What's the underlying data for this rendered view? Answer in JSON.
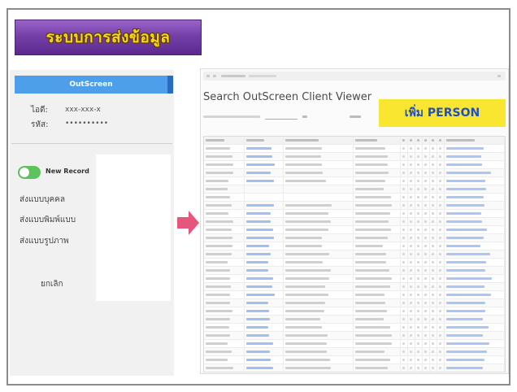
{
  "banner": {
    "title": "ระบบการส่งข้อมูล"
  },
  "login": {
    "button_label": "OutScreen",
    "id_label": "ไอดี:",
    "id_value": "xxx-xxx-x",
    "password_label": "รหัส:",
    "password_value": "••••••••••"
  },
  "options": {
    "toggle_label": "New Record",
    "items": [
      "ส่งแบบบุคคล",
      "ส่งแบบพิมพ์แบบ",
      "ส่งแบบรูปภาพ"
    ],
    "cancel_label": "ยกเลิก"
  },
  "viewer": {
    "title": "Search OutScreen Client Viewer",
    "add_button_label": "เพิ่ม PERSON"
  },
  "icons": {
    "arrow": "right-arrow-icon",
    "toggle": "toggle-switch"
  },
  "colors": {
    "banner_purple": "#7440a8",
    "banner_text": "#f7d51a",
    "login_blue": "#4d9fe9",
    "toggle_green": "#5cc45c",
    "arrow_pink": "#e6557c",
    "add_button_yellow": "#f8e631",
    "add_button_text": "#1f4fc8",
    "link_blue": "#8fb6ee"
  }
}
